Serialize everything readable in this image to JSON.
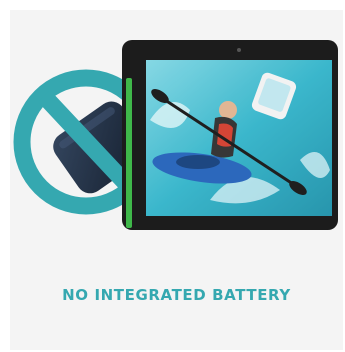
{
  "product": {
    "caption": "NO INTEGRATED BATTERY"
  },
  "colors": {
    "accent": "#35a8b0",
    "card_background": "#f4f4f4",
    "battery": "#22324a",
    "tablet_frame": "#1c1c1c",
    "led_strip": "#3fb84a",
    "screen_water": "#2fb3c9",
    "kayak": "#1f5fb8"
  },
  "icons": {
    "prohibition": "no-battery-prohibition-icon",
    "battery": "battery-icon",
    "device": "tablet-device"
  }
}
